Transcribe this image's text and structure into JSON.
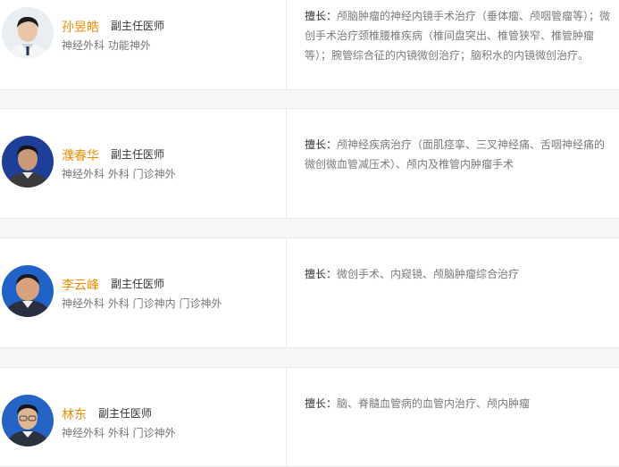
{
  "doctors": [
    {
      "name": "孙昱皓",
      "title": "副主任医师",
      "departments": "神经外科 功能神外",
      "specialty_label": "擅长：",
      "specialty_text": "颅脑肿瘤的神经内镜手术治疗（垂体瘤、颅咽管瘤等）；微创手术治疗颈椎腰椎疾病（椎间盘突出、椎管狭窄、椎管肿瘤等）；腕管综合征的内镜微创治疗；脑积水的内镜微创治疗。"
    },
    {
      "name": "濮春华",
      "title": "副主任医师",
      "departments": "神经外科 外科 门诊神外",
      "specialty_label": "擅长：",
      "specialty_text": "颅神经疾病治疗（面肌痉挛、三叉神经痛、舌咽神经痛的微创微血管减压术）、颅内及椎管内肿瘤手术"
    },
    {
      "name": "李云峰",
      "title": "副主任医师",
      "departments": "神经外科 外科 门诊神内 门诊神外",
      "specialty_label": "擅长：",
      "specialty_text": "微创手术、内窥镜、颅脑肿瘤综合治疗"
    },
    {
      "name": "林东",
      "title": "副主任医师",
      "departments": "神经外科 外科 门诊神外",
      "specialty_label": "擅长：",
      "specialty_text": "脑、脊髓血管病的血管内治疗、颅内肿瘤"
    }
  ],
  "colors": {
    "name": "#f08c00",
    "text": "#7a7a7a",
    "label": "#333333",
    "divider": "#ececec",
    "background": "#f6f6f6"
  }
}
